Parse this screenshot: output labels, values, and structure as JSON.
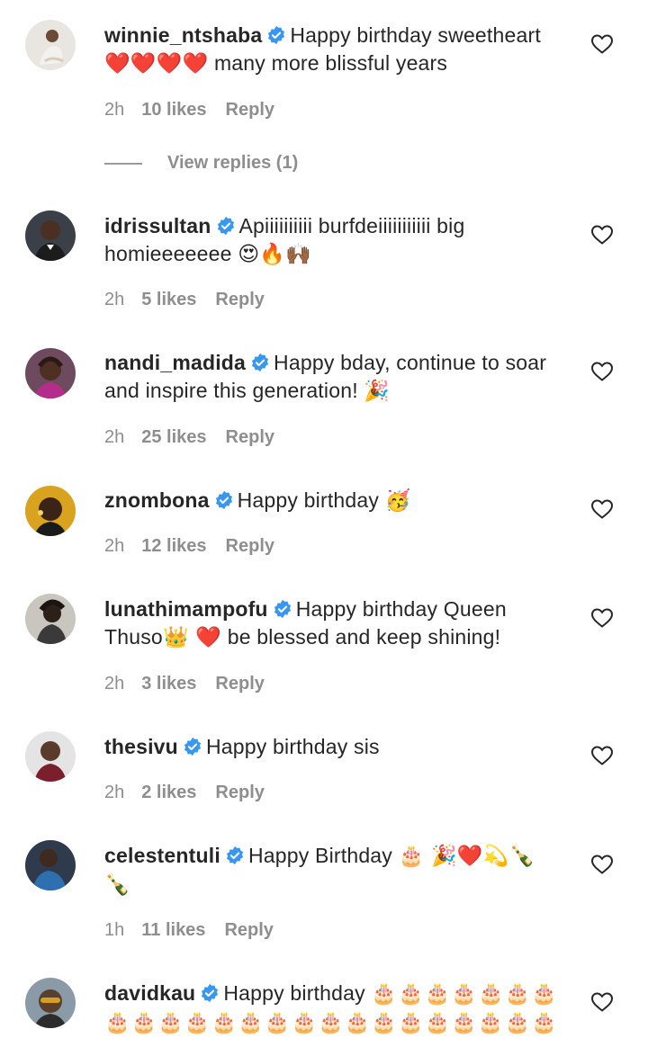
{
  "comments": [
    {
      "username": "winnie_ntshaba",
      "text": "Happy birthday sweetheart",
      "emoji_line": "❤️❤️❤️❤️",
      "text2": " many more blissful years",
      "time": "2h",
      "likes": "10 likes",
      "reply": "Reply"
    },
    {
      "username": "idrissultan",
      "text": "Apiiiiiiiiii burfdeiiiiiiiiiii big",
      "text2": "homieeeeeee",
      "emoji": "😍🔥🙌🏾",
      "time": "2h",
      "likes": "5 likes",
      "reply": "Reply"
    },
    {
      "username": "nandi_madida",
      "text": "Happy bday, continue to soar",
      "text2": "and inspire this generation!",
      "emoji": "🎉",
      "time": "2h",
      "likes": "25 likes",
      "reply": "Reply"
    },
    {
      "username": "znombona",
      "text": "Happy birthday",
      "emoji": "🥳",
      "time": "2h",
      "likes": "12 likes",
      "reply": "Reply"
    },
    {
      "username": "lunathimampofu",
      "text": "Happy birthday Queen",
      "text2": "Thuso",
      "emoji": "👑 ❤️",
      "text3": " be blessed and keep shining!",
      "time": "2h",
      "likes": "3 likes",
      "reply": "Reply"
    },
    {
      "username": "thesivu",
      "text": "Happy birthday sis",
      "time": "2h",
      "likes": "2 likes",
      "reply": "Reply"
    },
    {
      "username": "celestentuli",
      "text": "Happy Birthday",
      "emoji": "🎂 🎉❤️💫🍾",
      "emoji2": "🍾",
      "time": "1h",
      "likes": "11 likes",
      "reply": "Reply"
    },
    {
      "username": "davidkau",
      "text": "Happy birthday",
      "emoji": "🎂🎂🎂🎂🎂🎂🎂",
      "emoji2": "🎂🎂🎂🎂🎂🎂🎂🎂🎂🎂🎂🎂🎂🎂🎂🎂🎂"
    }
  ],
  "view_replies": "View replies (1)",
  "icons": {
    "verified": "verified-badge-icon",
    "like": "heart-outline-icon"
  },
  "colors": {
    "verified": "#3897f0",
    "muted": "#8e8e8e",
    "text": "#262626"
  }
}
